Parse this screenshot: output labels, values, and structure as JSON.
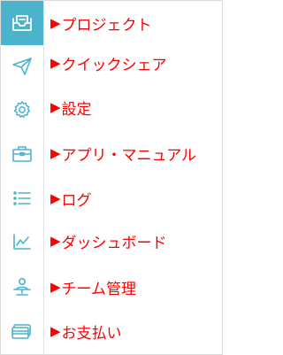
{
  "menu": {
    "items": [
      {
        "label": "プロジェクト",
        "icon": "project-inbox-icon",
        "active": true
      },
      {
        "label": "クイックシェア",
        "icon": "paper-plane-icon",
        "active": false
      },
      {
        "label": "設定",
        "icon": "gear-icon",
        "active": false
      },
      {
        "label": "アプリ・マニュアル",
        "icon": "briefcase-icon",
        "active": false
      },
      {
        "label": "ログ",
        "icon": "list-icon",
        "active": false
      },
      {
        "label": "ダッシュボード",
        "icon": "line-chart-icon",
        "active": false
      },
      {
        "label": "チーム管理",
        "icon": "team-user-icon",
        "active": false
      },
      {
        "label": "お支払い",
        "icon": "credit-card-icon",
        "active": false
      }
    ],
    "arrow_glyph": "▶"
  },
  "colors": {
    "accent": "#4bb4cc",
    "icon": "#4bb4cc",
    "annotation": "#ff0000",
    "active_icon": "#ffffff"
  }
}
